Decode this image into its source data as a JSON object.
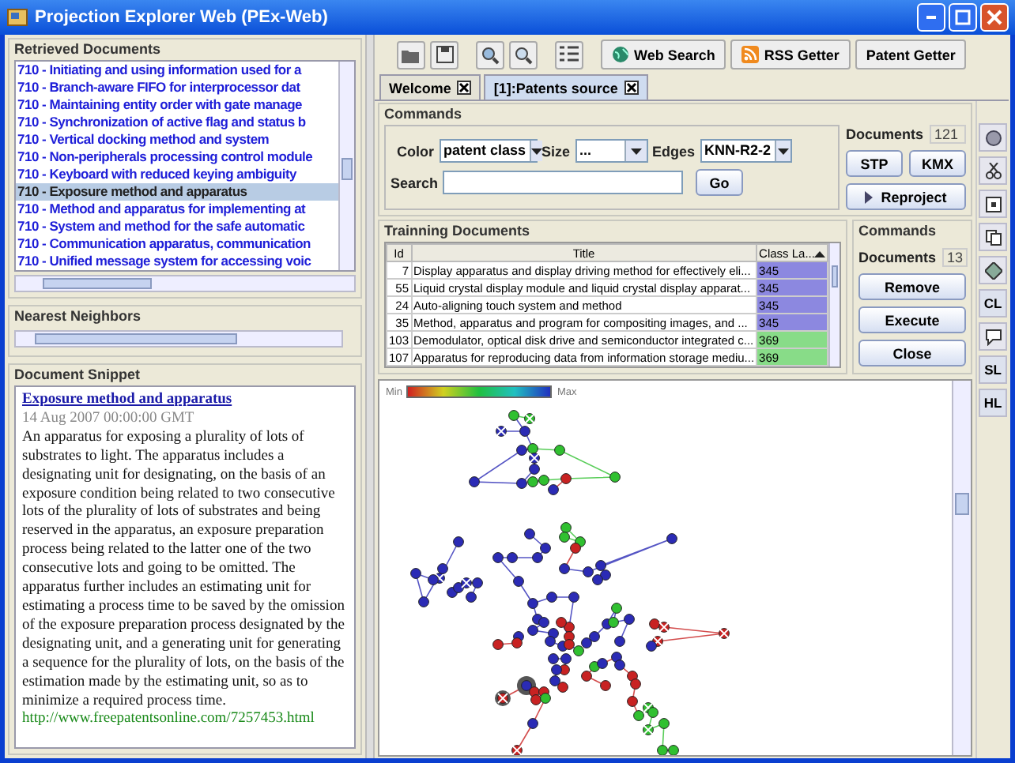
{
  "window": {
    "title": "Projection Explorer Web (PEx-Web)"
  },
  "retrieved_documents": {
    "title": "Retrieved Documents",
    "items": [
      {
        "label": "710 - Initiating and using information used for a",
        "selected": false
      },
      {
        "label": "710 - Branch-aware FIFO for interprocessor dat",
        "selected": false
      },
      {
        "label": "710 - Maintaining entity order with gate manage",
        "selected": false
      },
      {
        "label": "710 - Synchronization of active flag and status b",
        "selected": false
      },
      {
        "label": "710 - Vertical docking method and system",
        "selected": false
      },
      {
        "label": "710 - Non-peripherals processing control module",
        "selected": false
      },
      {
        "label": "710 - Keyboard with reduced keying ambiguity",
        "selected": false
      },
      {
        "label": "710 - Exposure method and apparatus",
        "selected": true
      },
      {
        "label": "710 - Method and apparatus for implementing at",
        "selected": false
      },
      {
        "label": "710 - System and method for the safe automatic",
        "selected": false
      },
      {
        "label": "710 - Communication apparatus, communication",
        "selected": false
      },
      {
        "label": "710 - Unified message system for accessing voic",
        "selected": false
      }
    ]
  },
  "nearest_neighbors": {
    "title": "Nearest Neighbors"
  },
  "document_snippet": {
    "title": "Document Snippet",
    "heading": "Exposure method and apparatus",
    "date": "14 Aug 2007 00:00:00 GMT",
    "body": "An apparatus for exposing a plurality of lots of substrates to light. The apparatus includes a designating unit for designating, on the basis of an exposure condition being related to two consecutive lots of the plurality of lots of substrates and being reserved in the apparatus, an exposure preparation process being related to the latter one of the two consecutive lots and going to be omitted. The apparatus further includes an estimating unit for estimating a process time to be saved by the omission of the exposure preparation process designated by the designating unit, and a generating unit for generating a sequence for the plurality of lots, on the basis of the estimation made by the estimating unit, so as to minimize a required process time.",
    "url": "http://www.freepatentsonline.com/7257453.html"
  },
  "toolbar": {
    "buttons": [
      {
        "label": "Web Search",
        "kind": "globe"
      },
      {
        "label": "RSS Getter",
        "kind": "rss"
      },
      {
        "label": "Patent Getter",
        "kind": "plain"
      }
    ]
  },
  "tabs": [
    {
      "label": "Welcome",
      "selected": false
    },
    {
      "label": "[1]:Patents source",
      "selected": true
    }
  ],
  "commands": {
    "title": "Commands",
    "color_label": "Color",
    "color_value": "patent class",
    "size_label": "Size",
    "size_value": "...",
    "edges_label": "Edges",
    "edges_value": "KNN-R2-2",
    "search_label": "Search",
    "go": "Go",
    "documents_label": "Documents",
    "documents_count": "121",
    "buttons": [
      "STP",
      "KMX"
    ],
    "reproject": "Reproject"
  },
  "training": {
    "title": "Trainning Documents",
    "columns": [
      "Id",
      "Title",
      "Class La..."
    ],
    "rows": [
      {
        "id": "7",
        "title": "Display apparatus and display driving method for effectively eli...",
        "class": "345",
        "color": "#8c88e0"
      },
      {
        "id": "55",
        "title": "Liquid crystal display module and liquid crystal display apparat...",
        "class": "345",
        "color": "#8c88e0"
      },
      {
        "id": "24",
        "title": "Auto-aligning touch system and method",
        "class": "345",
        "color": "#8c88e0"
      },
      {
        "id": "35",
        "title": "Method, apparatus and program for compositing images, and ...",
        "class": "345",
        "color": "#8c88e0"
      },
      {
        "id": "103",
        "title": "Demodulator, optical disk drive and semiconductor integrated c...",
        "class": "369",
        "color": "#88dc88"
      },
      {
        "id": "107",
        "title": "Apparatus for reproducing data from information storage mediu...",
        "class": "369",
        "color": "#88dc88"
      }
    ]
  },
  "training_commands": {
    "title": "Commands",
    "documents_label": "Documents",
    "documents_count": "13",
    "buttons": [
      "Remove",
      "Execute",
      "Close"
    ]
  },
  "projection": {
    "legend_min": "Min",
    "legend_max": "Max"
  },
  "side_toolbar": {
    "labels": [
      "CL",
      "SL",
      "HL"
    ]
  }
}
